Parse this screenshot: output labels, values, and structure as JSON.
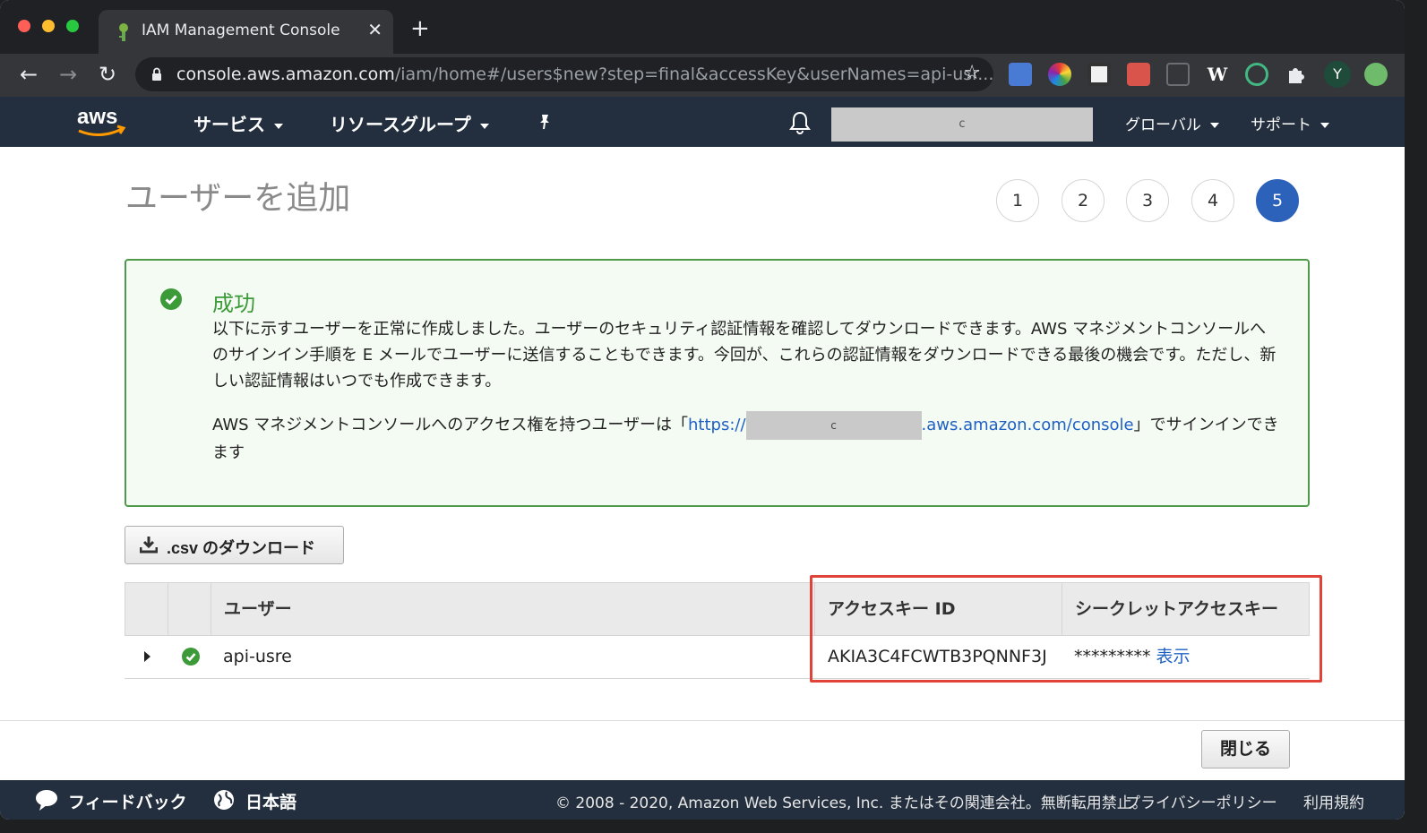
{
  "browser": {
    "tab_title": "IAM Management Console",
    "tab_close": "✕",
    "new_tab": "+",
    "url_host": "console.aws.amazon.com",
    "url_path": "/iam/home#/users$new?step=final&accessKey&userNames=api-usr...",
    "profile_initial": "Y",
    "nav_back": "←",
    "nav_forward": "→",
    "nav_reload": "↻",
    "star": "☆"
  },
  "aws_nav": {
    "services": "サービス",
    "resource_groups": "リソースグループ",
    "account_placeholder": "c",
    "region": "グローバル",
    "support": "サポート"
  },
  "page": {
    "title": "ユーザーを追加",
    "steps": [
      "1",
      "2",
      "3",
      "4",
      "5"
    ],
    "active_step": "5"
  },
  "alert": {
    "title": "成功",
    "body": "以下に示すユーザーを正常に作成しました。ユーザーのセキュリティ認証情報を確認してダウンロードできます。AWS マネジメントコンソールへのサインイン手順を E メールでユーザーに送信することもできます。今回が、これらの認証情報をダウンロードできる最後の機会です。ただし、新しい認証情報はいつでも作成できます。",
    "signin_prefix": "AWS マネジメントコンソールへのアクセス権を持つユーザーは「",
    "signin_link_start": "https://",
    "signin_redacted": "c",
    "signin_link_end": ".aws.amazon.com/console",
    "signin_suffix": "」でサインインできます"
  },
  "csv_button": ".csv のダウンロード",
  "table": {
    "headers": {
      "user": "ユーザー",
      "access_key_id": "アクセスキー ID",
      "secret_access_key": "シークレットアクセスキー"
    },
    "rows": [
      {
        "user": "api-usre",
        "access_key_id": "AKIA3C4FCWTB3PQNNF3J",
        "secret_masked": "*********",
        "show_link": "表示"
      }
    ]
  },
  "close_button": "閉じる",
  "footer": {
    "feedback": "フィードバック",
    "language": "日本語",
    "copyright": "© 2008 - 2020, Amazon Web Services, Inc. またはその関連会社。無断転用禁止。",
    "privacy": "プライバシーポリシー",
    "terms": "利用規約"
  },
  "colors": {
    "aws_nav_bg": "#232f3e",
    "success_green": "#3c9a39",
    "active_step_blue": "#2c62b9",
    "link_blue": "#1f60c4",
    "highlight_red": "#e04438"
  }
}
